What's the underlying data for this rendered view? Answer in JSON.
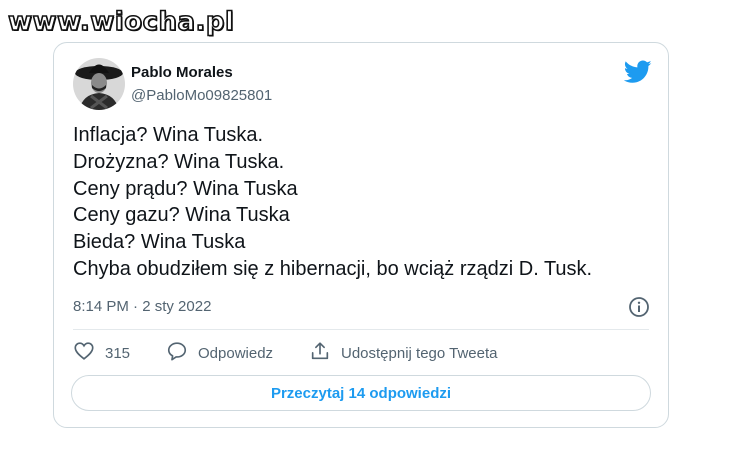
{
  "watermark": "www.wiocha.pl",
  "tweet": {
    "author_name": "Pablo Morales",
    "author_handle": "@PabloMo09825801",
    "lines": [
      "Inflacja? Wina Tuska.",
      "Drożyzna? Wina Tuska.",
      "Ceny prądu? Wina Tuska",
      "Ceny gazu? Wina Tuska",
      "Bieda? Wina Tuska",
      "Chyba obudziłem się z hibernacji, bo wciąż rządzi D. Tusk."
    ],
    "timestamp": "8:14 PM · 2 sty 2022"
  },
  "actions": {
    "like_count": "315",
    "reply_label": "Odpowiedz",
    "share_label": "Udostępnij tego Tweeta"
  },
  "read_replies_label": "Przeczytaj 14 odpowiedzi",
  "colors": {
    "accent": "#1d9bf0",
    "secondary_text": "#536471",
    "border": "#cfd9de"
  },
  "icons": [
    "twitter-bird-icon",
    "info-icon",
    "heart-icon",
    "reply-icon",
    "share-icon"
  ]
}
